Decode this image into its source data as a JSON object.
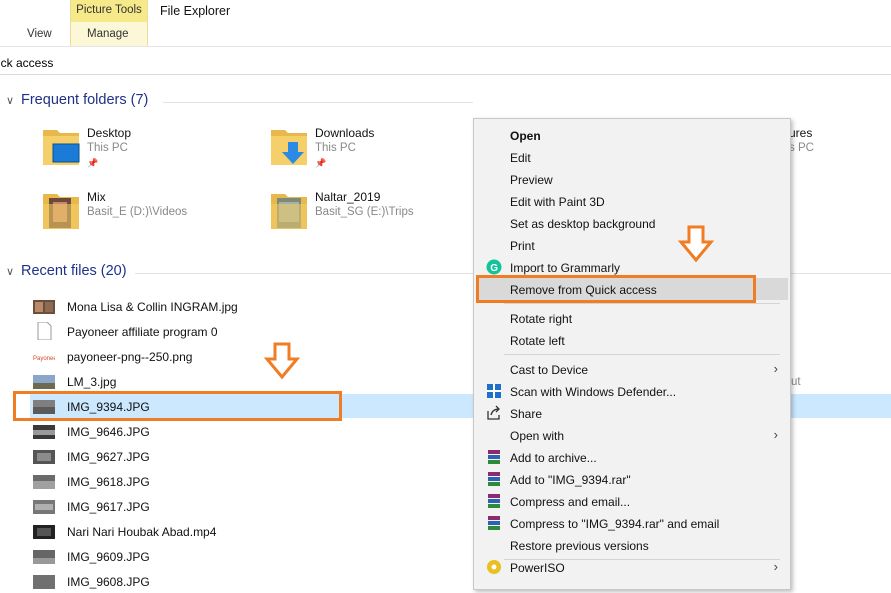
{
  "ribbon": {
    "tabs": [
      "View",
      "Manage"
    ],
    "context_header": "Picture Tools",
    "app_title": "File Explorer"
  },
  "address": {
    "text": "ick access"
  },
  "frequent": {
    "header": "Frequent folders (7)",
    "items": [
      {
        "name": "Desktop",
        "sub": "This PC",
        "pinned": true
      },
      {
        "name": "Downloads",
        "sub": "This PC",
        "pinned": true
      },
      {
        "name": "Mix",
        "sub": "Basit_E (D:)\\Videos",
        "pinned": false
      },
      {
        "name": "Naltar_2019",
        "sub": "Basit_SG (E:)\\Trips",
        "pinned": false
      },
      {
        "name": "ures",
        "sub": "s PC",
        "pinned": false
      }
    ]
  },
  "recent": {
    "header": "Recent files (20)",
    "files": [
      "Mona Lisa & Collin INGRAM.jpg",
      "Payoneer affiliate program 0",
      "payoneer-png--250.png",
      "LM_3.jpg",
      "IMG_9394.JPG",
      "IMG_9646.JPG",
      "IMG_9627.JPG",
      "IMG_9618.JPG",
      "IMG_9617.JPG",
      "Nari Nari Houbak Abad.mp4",
      "IMG_9609.JPG",
      "IMG_9608.JPG"
    ],
    "selected_index": 4,
    "partial_right_text": "ut"
  },
  "context_menu": {
    "items": [
      {
        "label": "Open",
        "bold": true,
        "icon": ""
      },
      {
        "label": "Edit",
        "icon": ""
      },
      {
        "label": "Preview",
        "icon": ""
      },
      {
        "label": "Edit with Paint 3D",
        "icon": ""
      },
      {
        "label": "Set as desktop background",
        "icon": ""
      },
      {
        "label": "Print",
        "icon": ""
      },
      {
        "label": "Import to Grammarly",
        "icon": "grammarly-icon"
      },
      {
        "label": "Remove from Quick access",
        "icon": "",
        "highlighted": true
      },
      {
        "label": "Rotate right",
        "icon": ""
      },
      {
        "label": "Rotate left",
        "icon": ""
      },
      {
        "label": "Cast to Device",
        "icon": "",
        "submenu": true
      },
      {
        "label": "Scan with Windows Defender...",
        "icon": "defender-icon"
      },
      {
        "label": "Share",
        "icon": "share-icon"
      },
      {
        "label": "Open with",
        "icon": "",
        "submenu": true
      },
      {
        "label": "Add to archive...",
        "icon": "winrar-icon"
      },
      {
        "label": "Add to \"IMG_9394.rar\"",
        "icon": "winrar-icon"
      },
      {
        "label": "Compress and email...",
        "icon": "winrar-icon"
      },
      {
        "label": "Compress to \"IMG_9394.rar\" and email",
        "icon": "winrar-icon"
      },
      {
        "label": "Restore previous versions",
        "icon": ""
      },
      {
        "label": "PowerISO",
        "icon": "poweriso-icon",
        "submenu": true
      }
    ]
  },
  "colors": {
    "accent_orange": "#f07c24",
    "selection": "#cce8ff",
    "header_blue": "#1e3287"
  }
}
